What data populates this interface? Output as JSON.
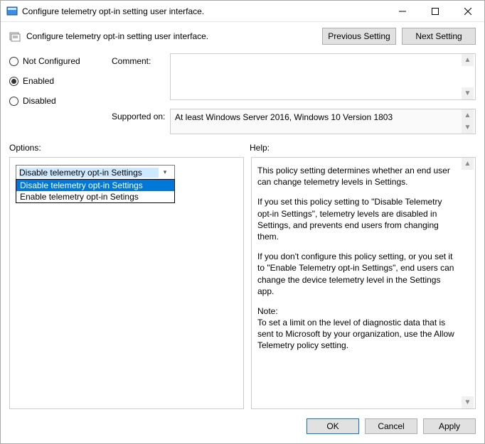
{
  "window": {
    "title": "Configure telemetry opt-in setting user interface."
  },
  "subheader": {
    "label": "Configure telemetry opt-in setting user interface.",
    "prev": "Previous Setting",
    "next": "Next Setting"
  },
  "radios": {
    "not_configured": "Not Configured",
    "enabled": "Enabled",
    "disabled": "Disabled",
    "selected": "enabled"
  },
  "fields": {
    "comment_label": "Comment:",
    "comment_value": "",
    "supported_label": "Supported on:",
    "supported_value": "At least Windows Server 2016, Windows 10 Version 1803"
  },
  "sections": {
    "options": "Options:",
    "help": "Help:"
  },
  "options_combo": {
    "value": "Disable telemetry opt-in Settings",
    "items": [
      "Disable telemetry opt-in Settings",
      "Enable telemetry opt-in Setings"
    ],
    "selected_index": 0
  },
  "help_text": {
    "p1": "This policy setting determines whether an end user can change telemetry levels in Settings.",
    "p2": "If you set this policy setting to \"Disable Telemetry opt-in Settings\", telemetry levels are disabled in Settings, and prevents end users from changing them.",
    "p3": "If you don't configure this policy setting, or you set it to \"Enable Telemetry opt-in Settings\", end users can change the device telemetry level in the Settings app.",
    "p4a": "Note:",
    "p4b": "To set a limit on the level of diagnostic data that is sent to Microsoft by your organization, use the Allow Telemetry policy setting."
  },
  "buttons": {
    "ok": "OK",
    "cancel": "Cancel",
    "apply": "Apply"
  }
}
